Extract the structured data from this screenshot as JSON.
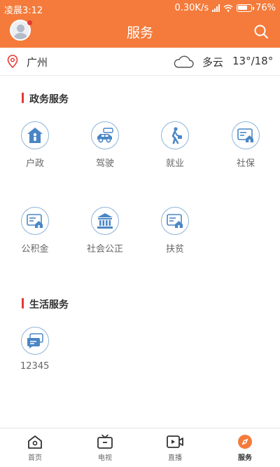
{
  "status_bar": {
    "time": "凌晨3:12",
    "network_speed": "0.30K/s",
    "battery": "76%"
  },
  "header": {
    "title": "服务"
  },
  "weather": {
    "city": "广州",
    "condition": "多云",
    "temperature": "13°/18°"
  },
  "government_services": {
    "title": "政务服务",
    "items": [
      {
        "label": "户政",
        "icon": "household-registration-icon"
      },
      {
        "label": "驾驶",
        "icon": "car-icon"
      },
      {
        "label": "就业",
        "icon": "employment-icon"
      },
      {
        "label": "社保",
        "icon": "social-security-icon"
      },
      {
        "label": "公积金",
        "icon": "provident-fund-icon"
      },
      {
        "label": "社会公正",
        "icon": "courthouse-icon"
      },
      {
        "label": "扶贫",
        "icon": "poverty-relief-icon"
      }
    ]
  },
  "life_services": {
    "title": "生活服务",
    "items": [
      {
        "label": "12345",
        "icon": "chat-bubble-icon"
      }
    ]
  },
  "tab_bar": {
    "tabs": [
      {
        "label": "首页",
        "icon": "home-icon"
      },
      {
        "label": "电视",
        "icon": "tv-icon"
      },
      {
        "label": "直播",
        "icon": "live-video-icon"
      },
      {
        "label": "服务",
        "icon": "compass-icon",
        "active": true
      }
    ]
  },
  "colors": {
    "accent": "#f47b3b",
    "icon_blue": "#4a86c5",
    "section_bar": "#e53935"
  }
}
